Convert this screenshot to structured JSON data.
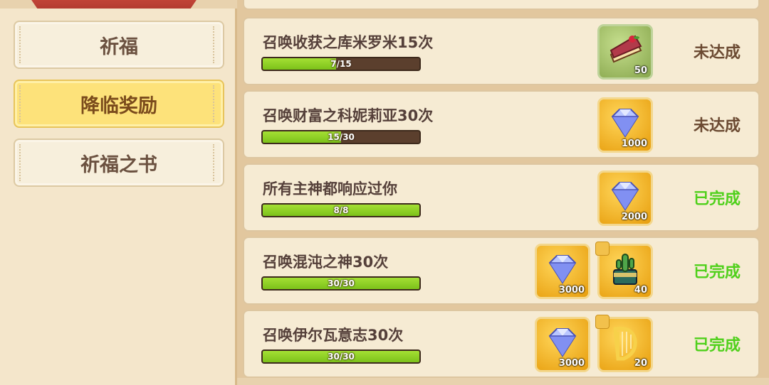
{
  "colors": {
    "pending": "#6b4a32",
    "done": "#4fd01b",
    "bar_fill": "#8fd224",
    "bar_track": "#5b3f2d"
  },
  "sidebar": {
    "items": [
      {
        "label": "祈福",
        "active": false
      },
      {
        "label": "降临奖励",
        "active": true
      },
      {
        "label": "祈福之书",
        "active": false
      }
    ]
  },
  "quests": [
    {
      "title": "召唤收获之库米罗米15次",
      "progress_text": "7/15",
      "progress": 0.4667,
      "rewards": [
        {
          "icon": "cake-icon",
          "qty": "50",
          "style": "green"
        }
      ],
      "status": "未达成",
      "completed": false
    },
    {
      "title": "召唤财富之科妮莉亚30次",
      "progress_text": "15/30",
      "progress": 0.5,
      "rewards": [
        {
          "icon": "diamond-icon",
          "qty": "1000",
          "style": "gold"
        }
      ],
      "status": "未达成",
      "completed": false
    },
    {
      "title": "所有主神都响应过你",
      "progress_text": "8/8",
      "progress": 1.0,
      "rewards": [
        {
          "icon": "diamond-icon",
          "qty": "2000",
          "style": "gold"
        }
      ],
      "status": "已完成",
      "completed": true
    },
    {
      "title": "召唤混沌之神30次",
      "progress_text": "30/30",
      "progress": 1.0,
      "rewards": [
        {
          "icon": "diamond-icon",
          "qty": "3000",
          "style": "gold"
        },
        {
          "icon": "cactus-pot-icon",
          "qty": "40",
          "style": "gold"
        }
      ],
      "status": "已完成",
      "completed": true
    },
    {
      "title": "召唤伊尔瓦意志30次",
      "progress_text": "30/30",
      "progress": 1.0,
      "rewards": [
        {
          "icon": "diamond-icon",
          "qty": "3000",
          "style": "gold"
        },
        {
          "icon": "harp-icon",
          "qty": "20",
          "style": "gold"
        }
      ],
      "status": "已完成",
      "completed": true
    }
  ]
}
